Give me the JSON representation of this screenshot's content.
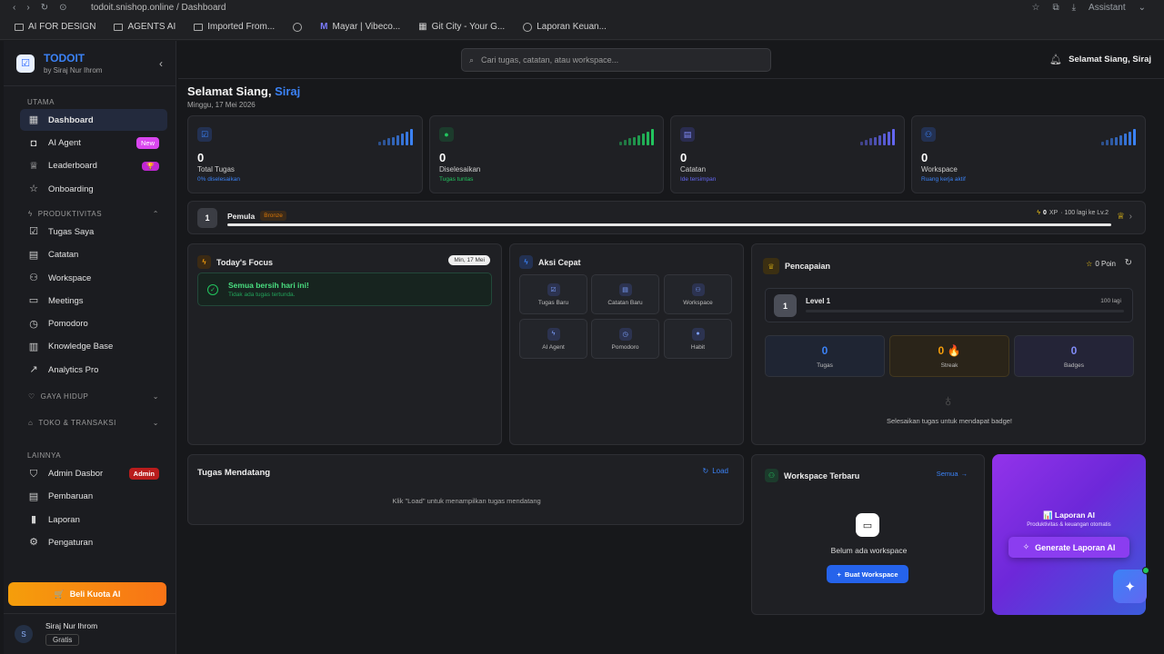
{
  "browser": {
    "url": "todoit.snishop.online / Dashboard",
    "assistant": "Assistant",
    "bookmarks": [
      "AI FOR DESIGN",
      "AGENTS AI",
      "Imported From...",
      "",
      "Mayar | Vibeco...",
      "Git City - Your G...",
      "Laporan Keuan..."
    ]
  },
  "brand": {
    "title": "TODOIT",
    "subtitle": "by Siraj Nur Ihrom"
  },
  "sidebar": {
    "section_utama": "UTAMA",
    "utama": [
      {
        "label": "Dashboard",
        "icon": "grid-icon"
      },
      {
        "label": "AI Agent",
        "icon": "robot-icon",
        "badge": "New"
      },
      {
        "label": "Leaderboard",
        "icon": "trophy-icon",
        "badge": "🏆"
      },
      {
        "label": "Onboarding",
        "icon": "star-icon"
      }
    ],
    "section_produktivitas": "PRODUKTIVITAS",
    "produktivitas": [
      {
        "label": "Tugas Saya",
        "icon": "checkbox-icon"
      },
      {
        "label": "Catatan",
        "icon": "note-icon"
      },
      {
        "label": "Workspace",
        "icon": "users-icon"
      },
      {
        "label": "Meetings",
        "icon": "video-icon"
      },
      {
        "label": "Pomodoro",
        "icon": "timer-icon"
      },
      {
        "label": "Knowledge Base",
        "icon": "book-icon"
      },
      {
        "label": "Analytics Pro",
        "icon": "trend-icon"
      }
    ],
    "section_gaya": "GAYA HIDUP",
    "section_toko": "TOKO & TRANSAKSI",
    "section_lainnya": "LAINNYA",
    "lainnya": [
      {
        "label": "Admin Dasbor",
        "icon": "shield-icon",
        "badge": "Admin"
      },
      {
        "label": "Pembaruan",
        "icon": "doc-icon"
      },
      {
        "label": "Laporan",
        "icon": "bar-chart-icon"
      },
      {
        "label": "Pengaturan",
        "icon": "gear-icon"
      }
    ],
    "buy_button": "Beli Kuota AI",
    "user_name": "Siraj Nur Ihrom",
    "user_initial": "S",
    "user_plan": "Gratis"
  },
  "topbar": {
    "search_placeholder": "Cari tugas, catatan, atau workspace...",
    "greeting": "Selamat Siang, Siraj"
  },
  "main": {
    "greeting_prefix": "Selamat Siang, ",
    "greeting_name": "Siraj",
    "date": "Minggu, 17 Mei 2026",
    "stats": [
      {
        "value": "0",
        "label": "Total Tugas",
        "sub": "0% diselesaikan",
        "color": "#3b82f6"
      },
      {
        "value": "0",
        "label": "Diselesaikan",
        "sub": "Tugas tuntas",
        "color": "#22c55e"
      },
      {
        "value": "0",
        "label": "Catatan",
        "sub": "Ide tersimpan",
        "color": "#6366f1"
      },
      {
        "value": "0",
        "label": "Workspace",
        "sub": "Ruang kerja aktif",
        "color": "#3b82f6"
      }
    ],
    "level": {
      "number": "1",
      "title": "Pemula",
      "tier": "Bronze",
      "xp": "0",
      "xp_unit": "XP",
      "next": "· 100 lagi ke Lv.2"
    },
    "focus": {
      "title": "Today's Focus",
      "date_chip": "Min, 17 Mei",
      "empty_title": "Semua bersih hari ini!",
      "empty_sub": "Tidak ada tugas tertunda."
    },
    "quick": {
      "title": "Aksi Cepat",
      "actions": [
        {
          "label": "Tugas Baru",
          "icon": "checkbox-icon"
        },
        {
          "label": "Catatan Baru",
          "icon": "note-icon"
        },
        {
          "label": "Workspace",
          "icon": "users-icon"
        },
        {
          "label": "AI Agent",
          "icon": "bolt-icon"
        },
        {
          "label": "Pomodoro",
          "icon": "timer-icon"
        },
        {
          "label": "Habit",
          "icon": "circle-icon"
        }
      ]
    },
    "achievements": {
      "title": "Pencapaian",
      "points": "0 Poin",
      "level_num": "1",
      "level_label": "Level 1",
      "level_remaining": "100 lagi",
      "tugas_val": "0",
      "tugas_label": "Tugas",
      "streak_val": "0 🔥",
      "streak_label": "Streak",
      "badges_val": "0",
      "badges_label": "Badges",
      "empty": "Selesaikan tugas untuk mendapat badge!"
    },
    "upcoming": {
      "title": "Tugas Mendatang",
      "load": "Load",
      "hint": "Klik \"Load\" untuk menampilkan tugas mendatang"
    },
    "workspace": {
      "title": "Workspace Terbaru",
      "all": "Semua",
      "empty": "Belum ada workspace",
      "create": "Buat Workspace"
    },
    "report": {
      "title": "📊 Laporan AI",
      "sub": "Produktivitas & keuangan otomatis",
      "button": "Generate Laporan AI"
    }
  }
}
